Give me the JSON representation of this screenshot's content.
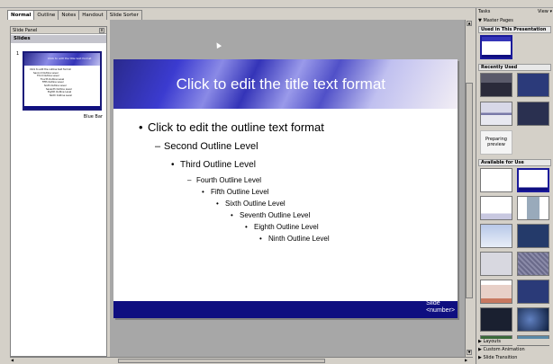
{
  "tabs": [
    "Normal",
    "Outline",
    "Notes",
    "Handout",
    "Slide Sorter"
  ],
  "slide_pane": {
    "title": "Slide Panel",
    "close": "x",
    "header": "Slides",
    "thumbnail": {
      "number": "1",
      "name": "Blue Bar",
      "title": "Click to edit the title text format",
      "lines": [
        "Click to edit the outline text format",
        "Second Outline Level",
        "Third Outline Level",
        "Fourth Outline Level",
        "Fifth Outline Level",
        "Sixth Outline Level",
        "Seventh Outline Level",
        "Eighth Outline Level",
        "Ninth Outline Level"
      ]
    }
  },
  "slide": {
    "title": "Click to edit the title text format",
    "outline": [
      {
        "bullet": "•",
        "text": "Click to edit the outline text format"
      },
      {
        "bullet": "–",
        "text": "Second Outline Level"
      },
      {
        "bullet": "•",
        "text": "Third Outline Level"
      },
      {
        "bullet": "–",
        "text": "Fourth Outline Level"
      },
      {
        "bullet": "•",
        "text": "Fifth Outline Level"
      },
      {
        "bullet": "•",
        "text": "Sixth Outline Level"
      },
      {
        "bullet": "•",
        "text": "Seventh Outline Level"
      },
      {
        "bullet": "•",
        "text": "Eighth Outline Level"
      },
      {
        "bullet": "•",
        "text": "Ninth Outline Level"
      }
    ],
    "slide_number": "Slide\n<number>"
  },
  "task_pane": {
    "title": "Tasks",
    "view_label": "View",
    "master_pages": "Master Pages",
    "used_in_presentation": "Used in This Presentation",
    "recently_used": "Recently Used",
    "preparing_preview": "Preparing preview",
    "available_for_use": "Available for Use",
    "layouts": "Layouts",
    "custom_animation": "Custom Animation",
    "slide_transition": "Slide Transition",
    "colors": {
      "accent": "#1a1a9a",
      "slide_band": "#3434b8",
      "footer": "#0e0e80"
    }
  }
}
